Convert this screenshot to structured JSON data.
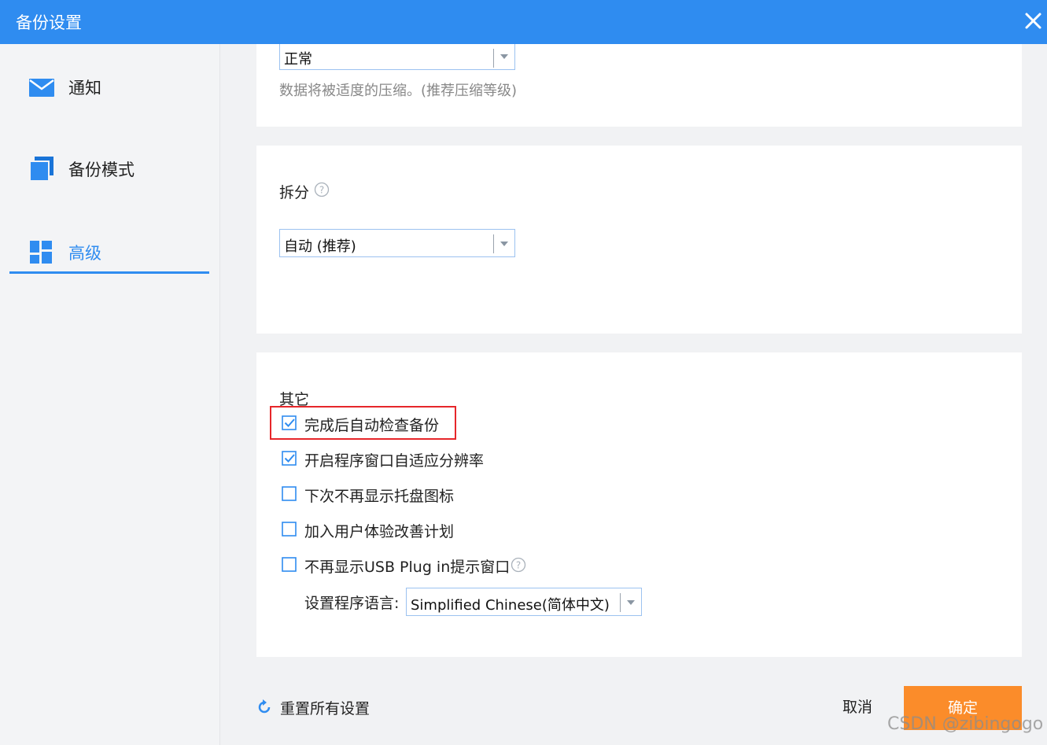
{
  "window": {
    "title": "备份设置",
    "accent_color": "#2f8cf0",
    "close_icon": "close-icon"
  },
  "sidebar": {
    "items": [
      {
        "label": "通知",
        "icon": "mail-icon",
        "active": false
      },
      {
        "label": "备份模式",
        "icon": "copy-icon",
        "active": false
      },
      {
        "label": "高级",
        "icon": "grid-icon",
        "active": true
      }
    ]
  },
  "compression": {
    "selected": "正常",
    "hint": "数据将被适度的压缩。(推荐压缩等级)"
  },
  "split": {
    "label": "拆分",
    "selected": "自动 (推荐)"
  },
  "other": {
    "title": "其它",
    "options": [
      {
        "label": "完成后自动检查备份",
        "checked": true
      },
      {
        "label": "开启程序窗口自适应分辨率",
        "checked": true
      },
      {
        "label": "下次不再显示托盘图标",
        "checked": false
      },
      {
        "label": "加入用户体验改善计划",
        "checked": false
      },
      {
        "label": "不再显示USB Plug in提示窗口",
        "checked": false
      }
    ],
    "language_label": "设置程序语言:",
    "language_selected": "Simplified Chinese(简体中文)"
  },
  "footer": {
    "reset_label": "重置所有设置",
    "cancel_label": "取消",
    "ok_label": "确定",
    "ok_color": "#fb8c2a"
  },
  "watermark": "CSDN @zibingogo"
}
